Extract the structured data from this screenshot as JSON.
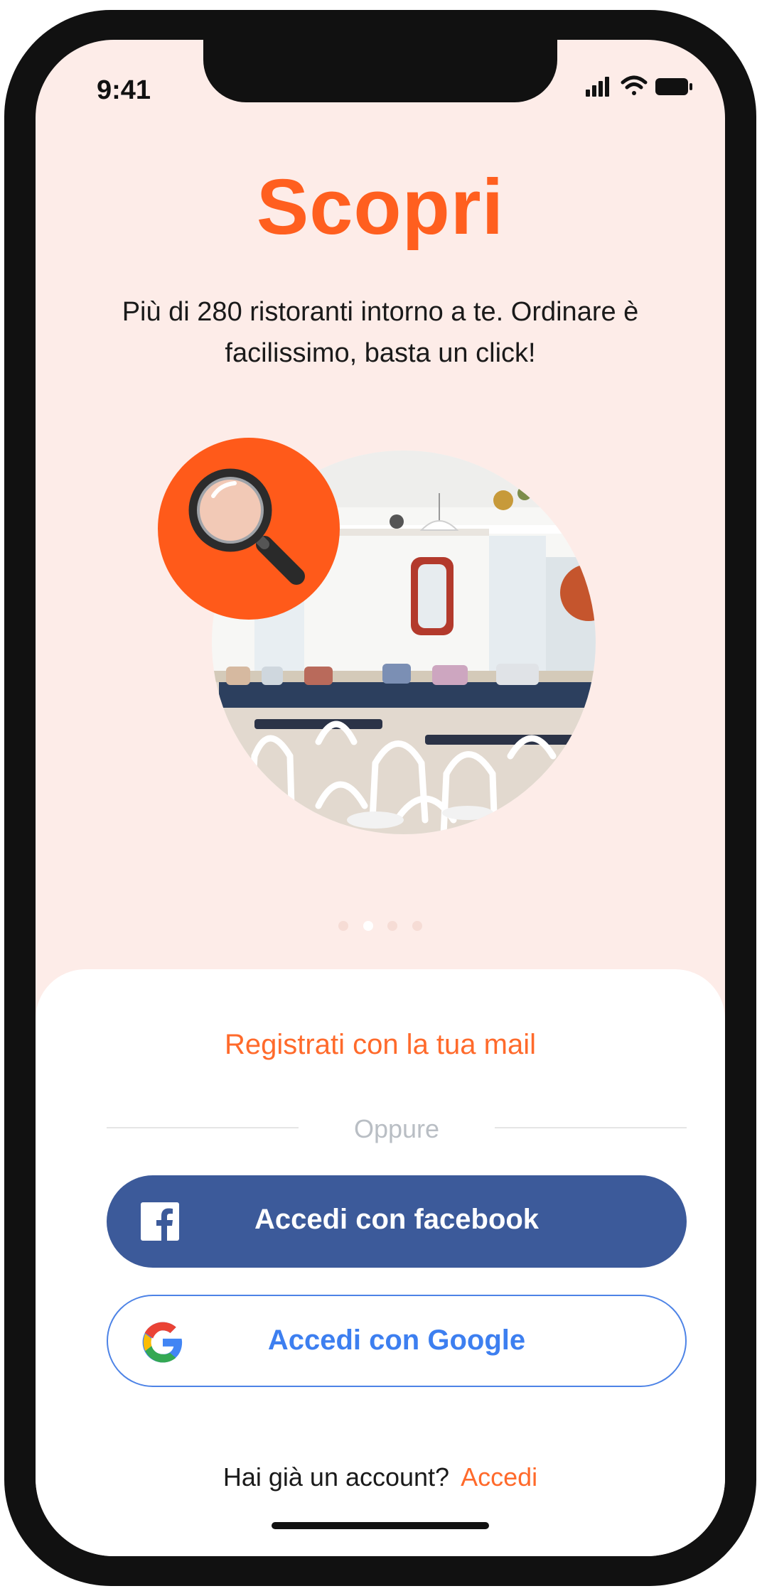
{
  "status_bar": {
    "time": "9:41"
  },
  "hero": {
    "title": "Scopri",
    "subtitle": "Più di 280 ristoranti intorno a te. Ordinare è facilissimo, basta un click!"
  },
  "carousel": {
    "page_count": 4,
    "active_index": 1
  },
  "auth": {
    "register_link": "Registrati con la tua mail",
    "divider_text": "Oppure",
    "facebook_button": "Accedi con facebook",
    "google_button": "Accedi con Google",
    "have_account_text": "Hai già un account?",
    "login_link": "Accedi"
  },
  "colors": {
    "accent": "#ff5f1f",
    "background": "#fdece8",
    "facebook": "#3c5a9a",
    "google_blue": "#3d7ff0"
  },
  "icons": [
    "signal-icon",
    "wifi-icon",
    "battery-icon",
    "magnifying-glass-icon",
    "facebook-icon",
    "google-icon"
  ]
}
